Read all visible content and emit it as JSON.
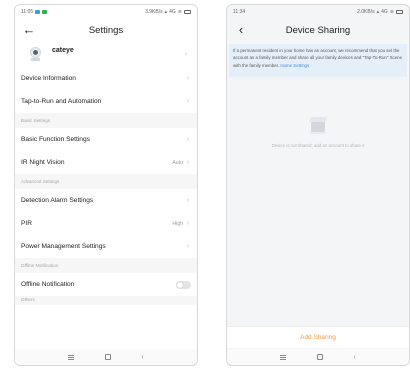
{
  "left_screen": {
    "status": {
      "time": "11:05",
      "network": "3.9KB/s",
      "signal": "4G"
    },
    "nav": {
      "title": "Settings"
    },
    "device": {
      "name": "cateye"
    },
    "rows_top": [
      {
        "label": "Device Information",
        "value": ""
      },
      {
        "label": "Tap-to-Run and Automation",
        "value": ""
      }
    ],
    "section_basic": "Basic Settings",
    "rows_basic": [
      {
        "label": "Basic Function Settings",
        "value": ""
      },
      {
        "label": "IR Night Vision",
        "value": "Auto"
      }
    ],
    "section_advanced": "Advanced Settings",
    "rows_advanced": [
      {
        "label": "Detection Alarm Settings",
        "value": ""
      },
      {
        "label": "PIR",
        "value": "High"
      },
      {
        "label": "Power Management Settings",
        "value": ""
      }
    ],
    "section_offline": "Offline Notification",
    "offline_row": {
      "label": "Offline Notification",
      "toggle_on": false
    },
    "section_others": "Others"
  },
  "right_screen": {
    "status": {
      "time": "11:34",
      "network": "2.0KB/s",
      "signal": "4G"
    },
    "nav": {
      "title": "Device Sharing"
    },
    "info": {
      "text": "If a permanent resident in your home has an account, we recommend that you set the account as a family member and share all your family devices and \"Tap-To-Run\" Scene with the family member.",
      "link": "Home Settings"
    },
    "empty_text": "Device is not shared, add an account to share it",
    "add_button": "Add Sharing"
  },
  "colors": {
    "accent_orange": "#f39a3c",
    "link_blue": "#3e8be0",
    "info_bg": "#e5eff9"
  }
}
